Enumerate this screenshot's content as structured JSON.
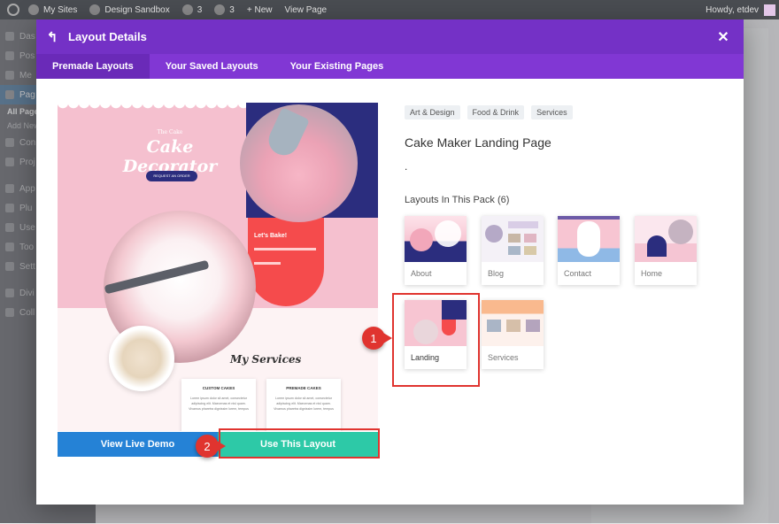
{
  "admin_bar": {
    "site": "My Sites",
    "sandbox": "Design Sandbox",
    "updates": "3",
    "comments": "3",
    "new": "+ New",
    "view_page": "View Page",
    "howdy": "Howdy, etdev"
  },
  "wp_sidebar": {
    "items": [
      "Das",
      "Pos",
      "Me",
      "Pag",
      "Con",
      "Proj",
      "App",
      "Plu",
      "Use",
      "Too",
      "Sett",
      "Divi",
      "Coll"
    ],
    "subitems": [
      "All Pages",
      "Add New"
    ]
  },
  "modal": {
    "title": "Layout Details",
    "back_icon": "arrow-back-icon",
    "close_label": "✕",
    "tabs": [
      {
        "label": "Premade Layouts",
        "active": true
      },
      {
        "label": "Your Saved Layouts",
        "active": false
      },
      {
        "label": "Your Existing Pages",
        "active": false
      }
    ],
    "preview": {
      "logo_small": "The Cake",
      "logo": "Cake Decorator",
      "order_button": "REQUEST AN ORDER",
      "lets_bake": "Let's Bake!",
      "services_heading": "My Services",
      "card1_title": "CUSTOM CAKES",
      "card1_text": "Lorem ipsum dolor sit amet, consectetur adipiscing elit. Maecenas et nisl quam. Vivamus pharetra dignissim lorem, tempus",
      "card2_title": "PREMADE CAKES",
      "card2_text": "Lorem ipsum dolor sit amet, consectetur adipiscing elit. Maecenas et nisl quam. Vivamus pharetra dignissim lorem, tempus"
    },
    "view_live_demo": "View Live Demo",
    "use_this_layout": "Use This Layout",
    "tags": [
      "Art & Design",
      "Food & Drink",
      "Services"
    ],
    "layout_title": "Cake Maker Landing Page",
    "description": ".",
    "pack_title": "Layouts In This Pack (6)",
    "layouts": [
      "About",
      "Blog",
      "Contact",
      "Home",
      "Landing",
      "Services"
    ],
    "callouts": [
      "1",
      "2"
    ]
  },
  "colors": {
    "header": "#7431c6",
    "tabs": "#8137d4",
    "live_demo": "#2582d6",
    "use_layout": "#2dc9a7",
    "highlight": "#e0342f"
  }
}
